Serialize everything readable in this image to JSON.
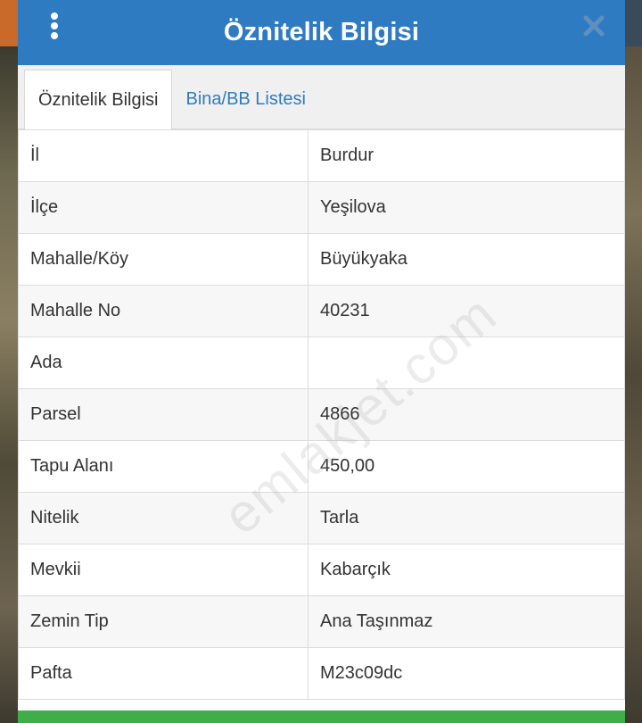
{
  "header": {
    "title": "Öznitelik Bilgisi",
    "menu_icon": "vertical-dots-icon",
    "close_icon": "close-icon",
    "bg_color": "#2f7bc2"
  },
  "tabs": [
    {
      "label": "Öznitelik Bilgisi",
      "active": true
    },
    {
      "label": "Bina/BB Listesi",
      "active": false
    }
  ],
  "rows": [
    {
      "key": "İl",
      "value": "Burdur"
    },
    {
      "key": "İlçe",
      "value": "Yeşilova"
    },
    {
      "key": "Mahalle/Köy",
      "value": "Büyükyaka"
    },
    {
      "key": "Mahalle No",
      "value": "40231"
    },
    {
      "key": "Ada",
      "value": ""
    },
    {
      "key": "Parsel",
      "value": "4866"
    },
    {
      "key": "Tapu Alanı",
      "value": "450,00"
    },
    {
      "key": "Nitelik",
      "value": "Tarla"
    },
    {
      "key": "Mevkii",
      "value": "Kabarçık"
    },
    {
      "key": "Zemin Tip",
      "value": "Ana Taşınmaz"
    },
    {
      "key": "Pafta",
      "value": "M23c09dc"
    }
  ],
  "watermark": "emlakjet.com",
  "footer_color": "#3fae49"
}
